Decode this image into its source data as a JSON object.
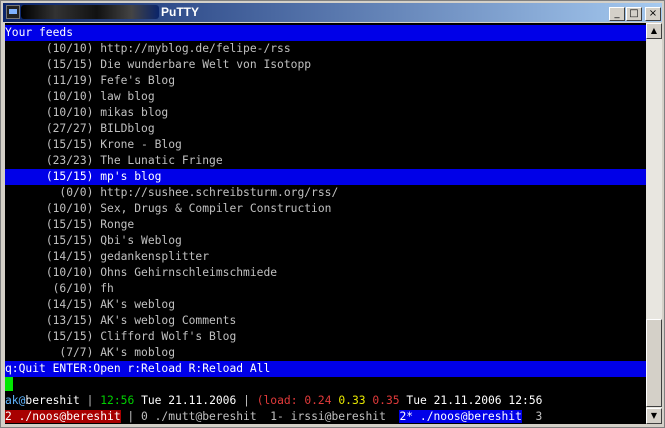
{
  "window": {
    "title": "PuTTY",
    "minimize": "_",
    "maximize": "□",
    "close": "×"
  },
  "terminal": {
    "header": "Your feeds",
    "feeds": [
      {
        "count": "(10/10)",
        "name": "http://myblog.de/felipe-/rss",
        "selected": false
      },
      {
        "count": "(15/15)",
        "name": "Die wunderbare Welt von Isotopp",
        "selected": false
      },
      {
        "count": "(11/19)",
        "name": "Fefe's Blog",
        "selected": false
      },
      {
        "count": "(10/10)",
        "name": "law blog",
        "selected": false
      },
      {
        "count": "(10/10)",
        "name": "mikas blog",
        "selected": false
      },
      {
        "count": "(27/27)",
        "name": "BILDblog",
        "selected": false
      },
      {
        "count": "(15/15)",
        "name": "Krone - Blog",
        "selected": false
      },
      {
        "count": "(23/23)",
        "name": "The Lunatic Fringe",
        "selected": false
      },
      {
        "count": "(15/15)",
        "name": "mp's blog",
        "selected": true
      },
      {
        "count": "(0/0)",
        "name": "http://sushee.schreibsturm.org/rss/",
        "selected": false
      },
      {
        "count": "(10/10)",
        "name": "Sex, Drugs & Compiler Construction",
        "selected": false
      },
      {
        "count": "(15/15)",
        "name": "Ronge",
        "selected": false
      },
      {
        "count": "(15/15)",
        "name": "Qbi's Weblog",
        "selected": false
      },
      {
        "count": "(14/15)",
        "name": "gedankensplitter",
        "selected": false
      },
      {
        "count": "(10/10)",
        "name": "Ohns Gehirnschleimschmiede",
        "selected": false
      },
      {
        "count": "(6/10)",
        "name": "fh",
        "selected": false
      },
      {
        "count": "(14/15)",
        "name": "AK's weblog",
        "selected": false
      },
      {
        "count": "(13/15)",
        "name": "AK's weblog Comments",
        "selected": false
      },
      {
        "count": "(15/15)",
        "name": "Clifford Wolf's Blog",
        "selected": false
      },
      {
        "count": "(7/7)",
        "name": "AK's moblog",
        "selected": false
      }
    ],
    "help_bar": "q:Quit ENTER:Open r:Reload R:Reload All",
    "status": {
      "user": "ak",
      "at": "@",
      "host": "bereshit",
      "sep1": " | ",
      "time_short": "12:56",
      "date1": " Tue 21.11.2006",
      "sep2": " | ",
      "load_label": "(load: ",
      "load1": "0.24",
      "load5": "0.33",
      "load15": "0.35",
      "date2": " Tue 21.11.2006 12:56"
    },
    "screen_tabs": [
      {
        "label": "2 ./noos@bereshit",
        "style": "red"
      },
      {
        "label": " | ",
        "style": "dark"
      },
      {
        "label": "0 ./mutt@bereshit",
        "style": "dark"
      },
      {
        "label": "  1- irssi@bereshit  ",
        "style": "dark"
      },
      {
        "label": "2* ./noos@bereshit",
        "style": "blue"
      },
      {
        "label": "  3",
        "style": "dark"
      }
    ]
  },
  "colors": {
    "highlight": "#0000e8",
    "terminal_bg": "#000000",
    "title_gradient_start": "#0a246a",
    "cursor": "#00e800"
  }
}
